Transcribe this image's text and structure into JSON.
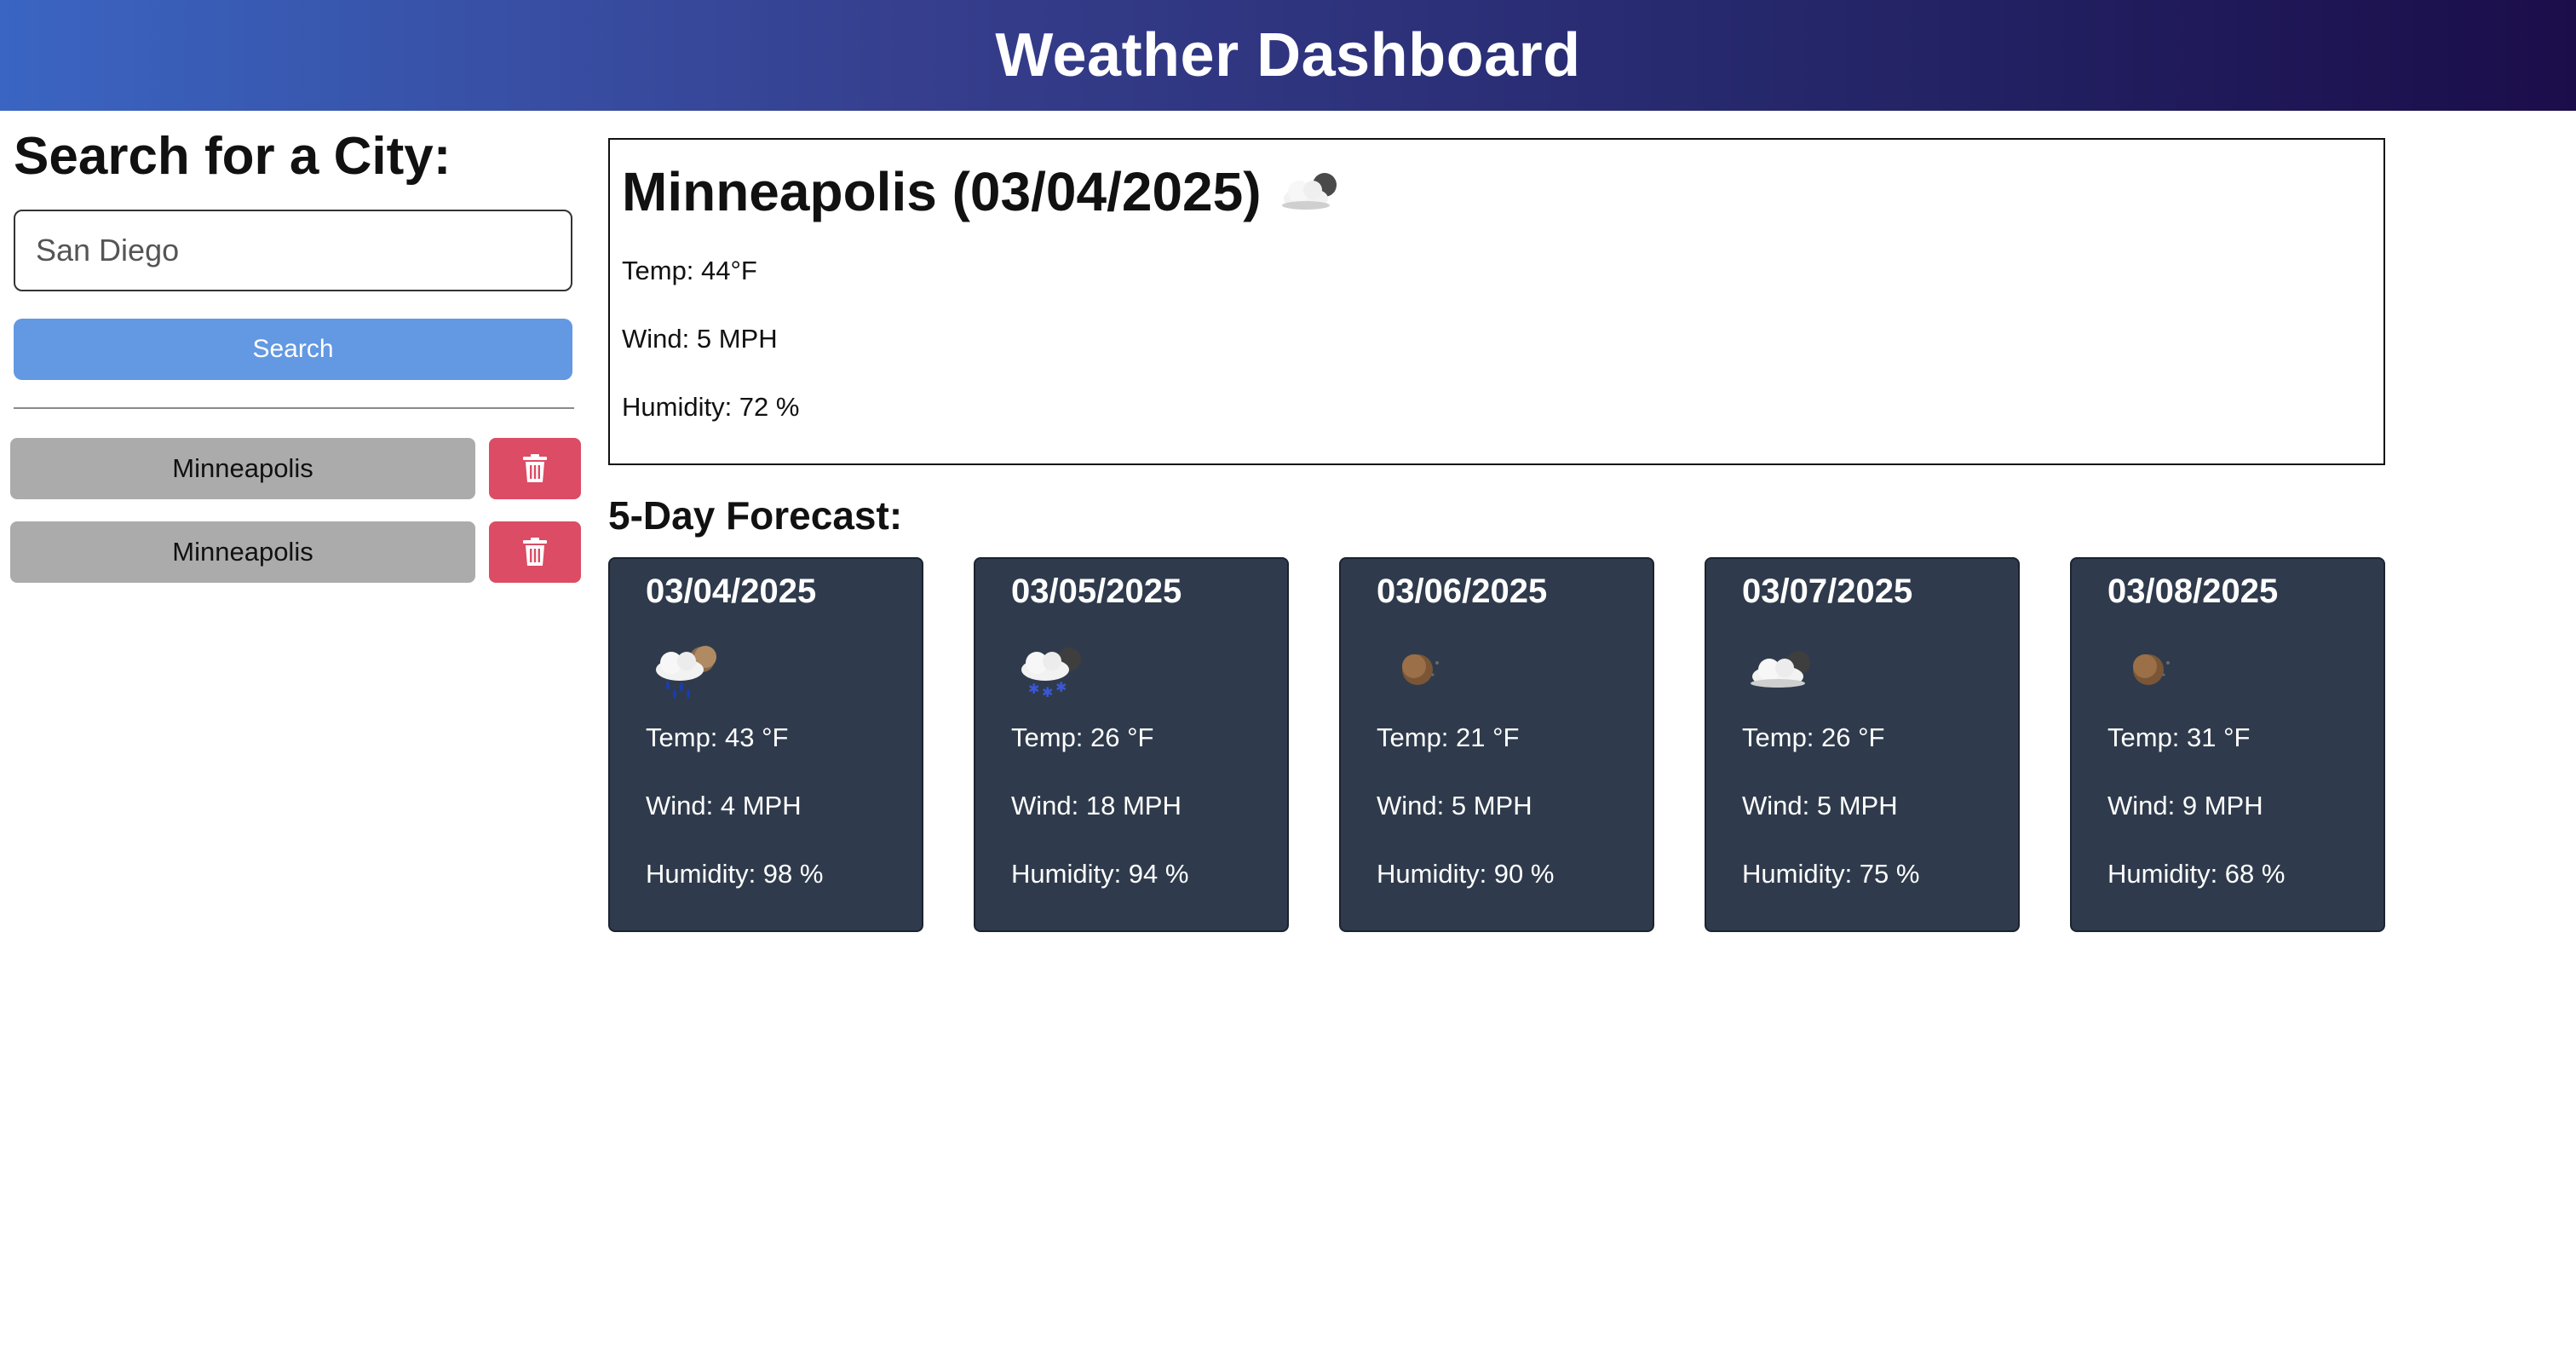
{
  "header": {
    "title": "Weather Dashboard"
  },
  "sidebar": {
    "search_title": "Search for a City:",
    "input_value": "San Diego",
    "search_label": "Search",
    "history": [
      {
        "city": "Minneapolis"
      },
      {
        "city": "Minneapolis"
      }
    ]
  },
  "current": {
    "title": "Minneapolis (03/04/2025)",
    "icon": "cloudy-night-icon",
    "temp": "Temp: 44°F",
    "wind": "Wind: 5 MPH",
    "humidity": "Humidity: 72 %"
  },
  "forecast": {
    "title": "5-Day Forecast:",
    "days": [
      {
        "date": "03/04/2025",
        "icon": "rain-night-icon",
        "temp": "Temp: 43 °F",
        "wind": "Wind: 4 MPH",
        "humidity": "Humidity: 98 %"
      },
      {
        "date": "03/05/2025",
        "icon": "snow-night-icon",
        "temp": "Temp: 26 °F",
        "wind": "Wind: 18 MPH",
        "humidity": "Humidity: 94 %"
      },
      {
        "date": "03/06/2025",
        "icon": "clear-night-icon",
        "temp": "Temp: 21 °F",
        "wind": "Wind: 5 MPH",
        "humidity": "Humidity: 90 %"
      },
      {
        "date": "03/07/2025",
        "icon": "cloudy-night-icon",
        "temp": "Temp: 26 °F",
        "wind": "Wind: 5 MPH",
        "humidity": "Humidity: 75 %"
      },
      {
        "date": "03/08/2025",
        "icon": "clear-night-icon",
        "temp": "Temp: 31 °F",
        "wind": "Wind: 9 MPH",
        "humidity": "Humidity: 68 %"
      }
    ]
  },
  "colors": {
    "search_button": "#6398e2",
    "delete_button": "#dc4c64",
    "history_button": "#ababab",
    "forecast_card": "#2f3b4c"
  }
}
